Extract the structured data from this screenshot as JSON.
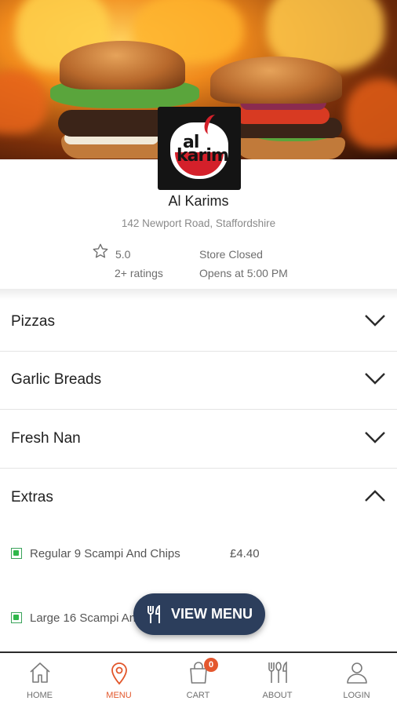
{
  "store": {
    "name": "Al Karims",
    "address": "142 Newport Road, Staffordshire",
    "rating": "5.0",
    "ratings_count": "2+ ratings",
    "status": "Store Closed",
    "opens": "Opens at 5:00 PM",
    "logo_line1": "al",
    "logo_line2": "karim"
  },
  "categories": [
    {
      "label": "Pizzas",
      "icon": "chevron-down-icon"
    },
    {
      "label": "Garlic Breads",
      "icon": "chevron-down-icon"
    },
    {
      "label": "Fresh Nan",
      "icon": "chevron-down-icon"
    },
    {
      "label": "Extras",
      "icon": "chevron-up-icon"
    }
  ],
  "items": [
    {
      "name": "Regular 9 Scampi And Chips",
      "price": "£4.40"
    },
    {
      "name": "Large 16 Scampi And Chips",
      "price": ""
    }
  ],
  "fab": {
    "label": "VIEW MENU",
    "icon": "cutlery-icon"
  },
  "cart_count": "0",
  "tabs": [
    {
      "label": "HOME",
      "icon": "home-icon"
    },
    {
      "label": "MENU",
      "icon": "location-pin-icon"
    },
    {
      "label": "CART",
      "icon": "shopping-bag-icon"
    },
    {
      "label": "ABOUT",
      "icon": "cutlery-icon"
    },
    {
      "label": "LOGIN",
      "icon": "user-icon"
    }
  ],
  "colors": {
    "accent": "#e2562a",
    "fab_bg": "#2c3e5c",
    "veg_green": "#2fb84a",
    "logo_red": "#d4202a"
  }
}
